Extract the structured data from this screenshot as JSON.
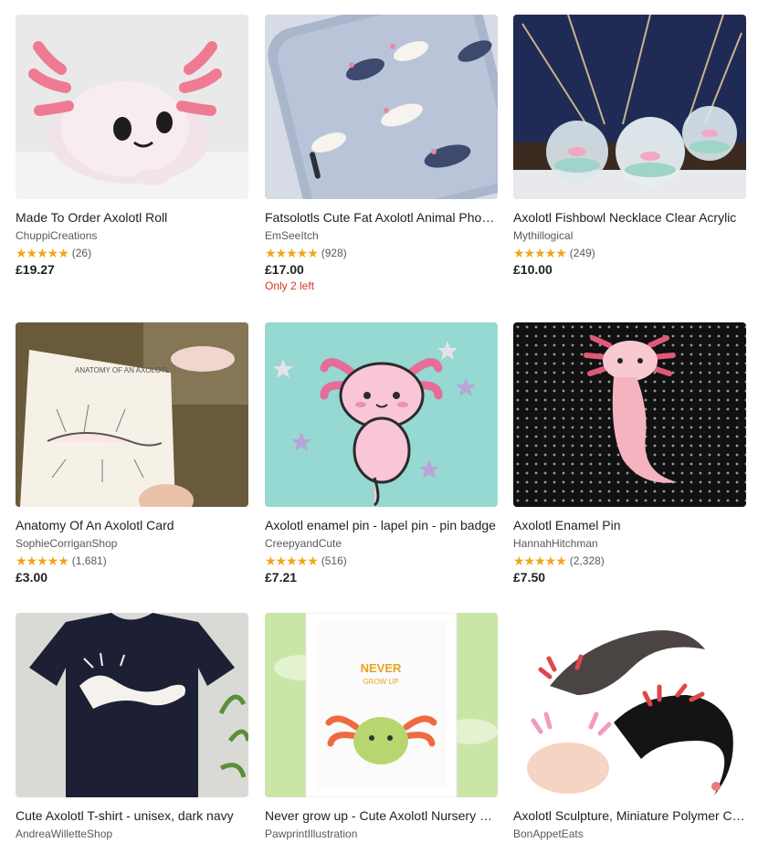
{
  "colors": {
    "star": "#f1a51c",
    "low_stock": "#d1391f",
    "text": "#222222",
    "muted": "#595959"
  },
  "listings": [
    {
      "title": "Made To Order Axolotl Roll",
      "shop": "ChuppiCreations",
      "stars": "★★★★★",
      "reviews": "(26)",
      "price": "£19.27",
      "stock": "",
      "image": "plush-axolotl-image"
    },
    {
      "title": "Fatsolotls Cute Fat Axolotl Animal Phone Case",
      "shop": "EmSeeItch",
      "stars": "★★★★★",
      "reviews": "(928)",
      "price": "£17.00",
      "stock": "Only 2 left",
      "image": "phone-case-image"
    },
    {
      "title": "Axolotl Fishbowl Necklace Clear Acrylic",
      "shop": "Mythillogical",
      "stars": "★★★★★",
      "reviews": "(249)",
      "price": "£10.00",
      "stock": "",
      "image": "fishbowl-necklace-image"
    },
    {
      "title": "Anatomy Of An Axolotl Card",
      "shop": "SophieCorriganShop",
      "stars": "★★★★★",
      "reviews": "(1,681)",
      "price": "£3.00",
      "stock": "",
      "image": "anatomy-card-image"
    },
    {
      "title": "Axolotl enamel pin - lapel pin - pin badge",
      "shop": "CreepyandCute",
      "stars": "★★★★★",
      "reviews": "(516)",
      "price": "£7.21",
      "stock": "",
      "image": "enamel-pin-image"
    },
    {
      "title": "Axolotl Enamel Pin",
      "shop": "HannahHitchman",
      "stars": "★★★★★",
      "reviews": "(2,328)",
      "price": "£7.50",
      "stock": "",
      "image": "enamel-pin-dark-image"
    },
    {
      "title": "Cute Axolotl T-shirt - unisex, dark navy",
      "shop": "AndreaWilletteShop",
      "stars": "",
      "reviews": "",
      "price": "",
      "stock": "",
      "image": "tshirt-image"
    },
    {
      "title": "Never grow up - Cute Axolotl Nursery Print",
      "shop": "PawprintIllustration",
      "stars": "",
      "reviews": "",
      "price": "",
      "stock": "",
      "image": "nursery-print-image"
    },
    {
      "title": "Axolotl Sculpture, Miniature Polymer Clay",
      "shop": "BonAppetEats",
      "stars": "",
      "reviews": "",
      "price": "",
      "stock": "",
      "image": "sculpture-image"
    }
  ],
  "art": {
    "card_text": "ANATOMY OF AN AXOLOTL",
    "print_line1": "NEVER",
    "print_line2": "GROW UP"
  }
}
